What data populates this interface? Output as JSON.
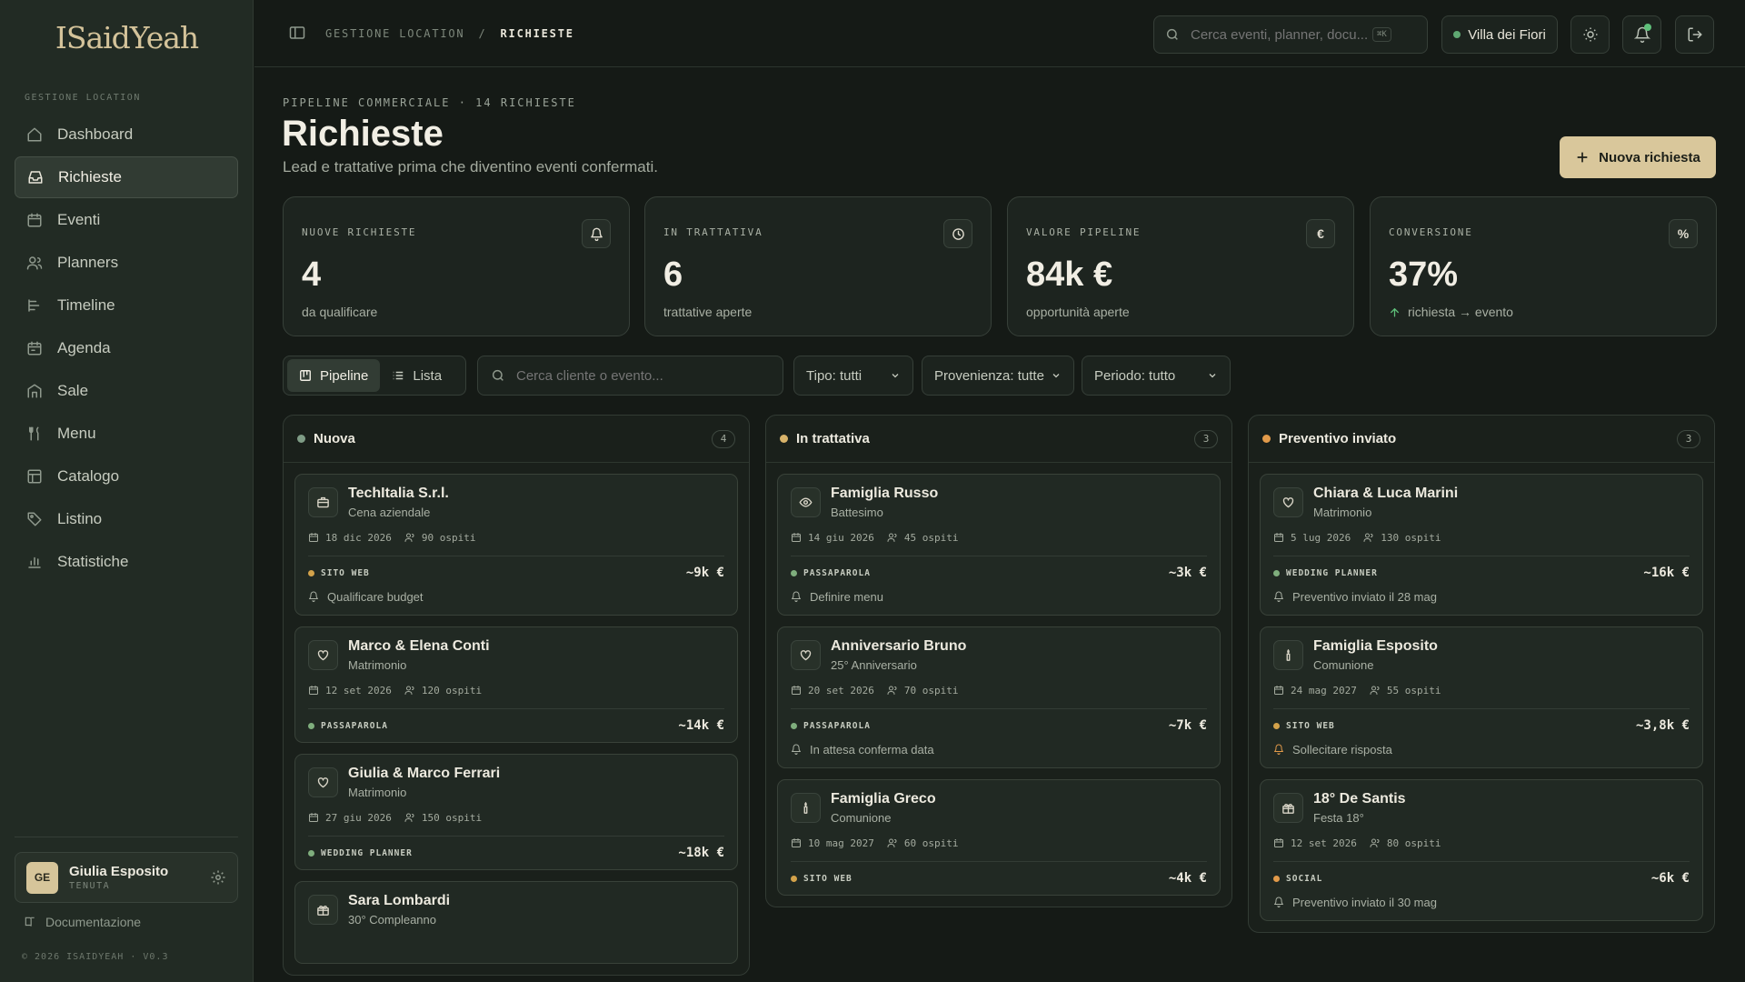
{
  "app": {
    "logo": "ISaidYeah",
    "section_label": "GESTIONE LOCATION",
    "copyright": "© 2026 ISAIDYEAH · V0.3",
    "docs": "Documentazione"
  },
  "sidebar": {
    "items": [
      {
        "label": "Dashboard",
        "icon": "home-icon"
      },
      {
        "label": "Richieste",
        "icon": "inbox-icon"
      },
      {
        "label": "Eventi",
        "icon": "calendar-icon"
      },
      {
        "label": "Planners",
        "icon": "users-icon"
      },
      {
        "label": "Timeline",
        "icon": "timeline-icon"
      },
      {
        "label": "Agenda",
        "icon": "agenda-icon"
      },
      {
        "label": "Sale",
        "icon": "building-icon"
      },
      {
        "label": "Menu",
        "icon": "cutlery-icon"
      },
      {
        "label": "Catalogo",
        "icon": "catalog-icon"
      },
      {
        "label": "Listino",
        "icon": "tag-icon"
      },
      {
        "label": "Statistiche",
        "icon": "bar-chart-icon"
      }
    ],
    "active": "Richieste"
  },
  "user": {
    "initials": "GE",
    "name": "Giulia Esposito",
    "role": "TENUTA"
  },
  "header": {
    "crumb_root": "GESTIONE LOCATION",
    "crumb_sep": "/",
    "crumb_current": "RICHIESTE",
    "search_placeholder": "Cerca eventi, planner, docu...",
    "search_shortcut": "⌘K",
    "venue": "Villa dei Fiori",
    "venue_status_color": "#5fa872"
  },
  "page": {
    "overline": "PIPELINE COMMERCIALE · 14 RICHIESTE",
    "title": "Richieste",
    "subtitle": "Lead e trattative prima che diventino eventi confermati.",
    "new_button": "Nuova richiesta"
  },
  "stats": [
    {
      "label": "NUOVE RICHIESTE",
      "value": "4",
      "note": "da qualificare",
      "icon": "bell-icon"
    },
    {
      "label": "IN TRATTATIVA",
      "value": "6",
      "note": "trattative aperte",
      "icon": "clock-icon"
    },
    {
      "label": "VALORE PIPELINE",
      "value": "84k €",
      "note": "opportunità aperte",
      "icon_text": "€"
    },
    {
      "label": "CONVERSIONE",
      "value": "37%",
      "note": "richiesta → evento",
      "icon_text": "%"
    }
  ],
  "toolbar": {
    "view_pipeline": "Pipeline",
    "view_list": "Lista",
    "filter_placeholder": "Cerca cliente o evento...",
    "type_filter": "Tipo: tutti",
    "source_filter": "Provenienza: tutte",
    "period_filter": "Periodo: tutto"
  },
  "columns": [
    {
      "title": "Nuova",
      "count": "4",
      "color": "#7f9c86",
      "cards": [
        {
          "name": "TechItalia S.r.l.",
          "type": "Cena aziendale",
          "date": "18 dic 2026",
          "guests": "90 ospiti",
          "source": "SITO WEB",
          "source_color": "#d3a24a",
          "amount": "~9k €",
          "task": "Qualificare budget",
          "icon": "briefcase-icon"
        },
        {
          "name": "Marco & Elena Conti",
          "type": "Matrimonio",
          "date": "12 set 2026",
          "guests": "120 ospiti",
          "source": "PASSAPAROLA",
          "source_color": "#7fae7d",
          "amount": "~14k €",
          "task": "",
          "icon": "heart-icon"
        },
        {
          "name": "Giulia & Marco Ferrari",
          "type": "Matrimonio",
          "date": "27 giu 2026",
          "guests": "150 ospiti",
          "source": "WEDDING PLANNER",
          "source_color": "#7fae7d",
          "amount": "~18k €",
          "task": "",
          "icon": "heart-icon"
        },
        {
          "name": "Sara Lombardi",
          "type": "30° Compleanno",
          "date": "",
          "guests": "",
          "source": "",
          "amount": "",
          "task": "",
          "icon": "gift-icon"
        }
      ]
    },
    {
      "title": "In trattativa",
      "count": "3",
      "color": "#d8b36a",
      "cards": [
        {
          "name": "Famiglia Russo",
          "type": "Battesimo",
          "date": "14 giu 2026",
          "guests": "45 ospiti",
          "source": "PASSAPAROLA",
          "source_color": "#7fae7d",
          "amount": "~3k €",
          "task": "Definire menu",
          "icon": "eye-icon"
        },
        {
          "name": "Anniversario Bruno",
          "type": "25° Anniversario",
          "date": "20 set 2026",
          "guests": "70 ospiti",
          "source": "PASSAPAROLA",
          "source_color": "#7fae7d",
          "amount": "~7k €",
          "task": "In attesa conferma data",
          "icon": "heart-icon"
        },
        {
          "name": "Famiglia Greco",
          "type": "Comunione",
          "date": "10 mag 2027",
          "guests": "60 ospiti",
          "source": "SITO WEB",
          "source_color": "#d3a24a",
          "amount": "~4k €",
          "task": "",
          "icon": "candle-icon"
        }
      ]
    },
    {
      "title": "Preventivo inviato",
      "count": "3",
      "color": "#e29a4a",
      "cards": [
        {
          "name": "Chiara & Luca Marini",
          "type": "Matrimonio",
          "date": "5 lug 2026",
          "guests": "130 ospiti",
          "source": "WEDDING PLANNER",
          "source_color": "#7fae7d",
          "amount": "~16k €",
          "task": "Preventivo inviato il 28 mag",
          "icon": "heart-icon"
        },
        {
          "name": "Famiglia Esposito",
          "type": "Comunione",
          "date": "24 mag 2027",
          "guests": "55 ospiti",
          "source": "SITO WEB",
          "source_color": "#d3a24a",
          "amount": "~3,8k €",
          "task": "Sollecitare risposta",
          "task_warn": true,
          "icon": "candle-icon"
        },
        {
          "name": "18° De Santis",
          "type": "Festa 18°",
          "date": "12 set 2026",
          "guests": "80 ospiti",
          "source": "SOCIAL",
          "source_color": "#e29a4a",
          "amount": "~6k €",
          "task": "Preventivo inviato il 30 mag",
          "icon": "gift-icon"
        }
      ]
    }
  ]
}
